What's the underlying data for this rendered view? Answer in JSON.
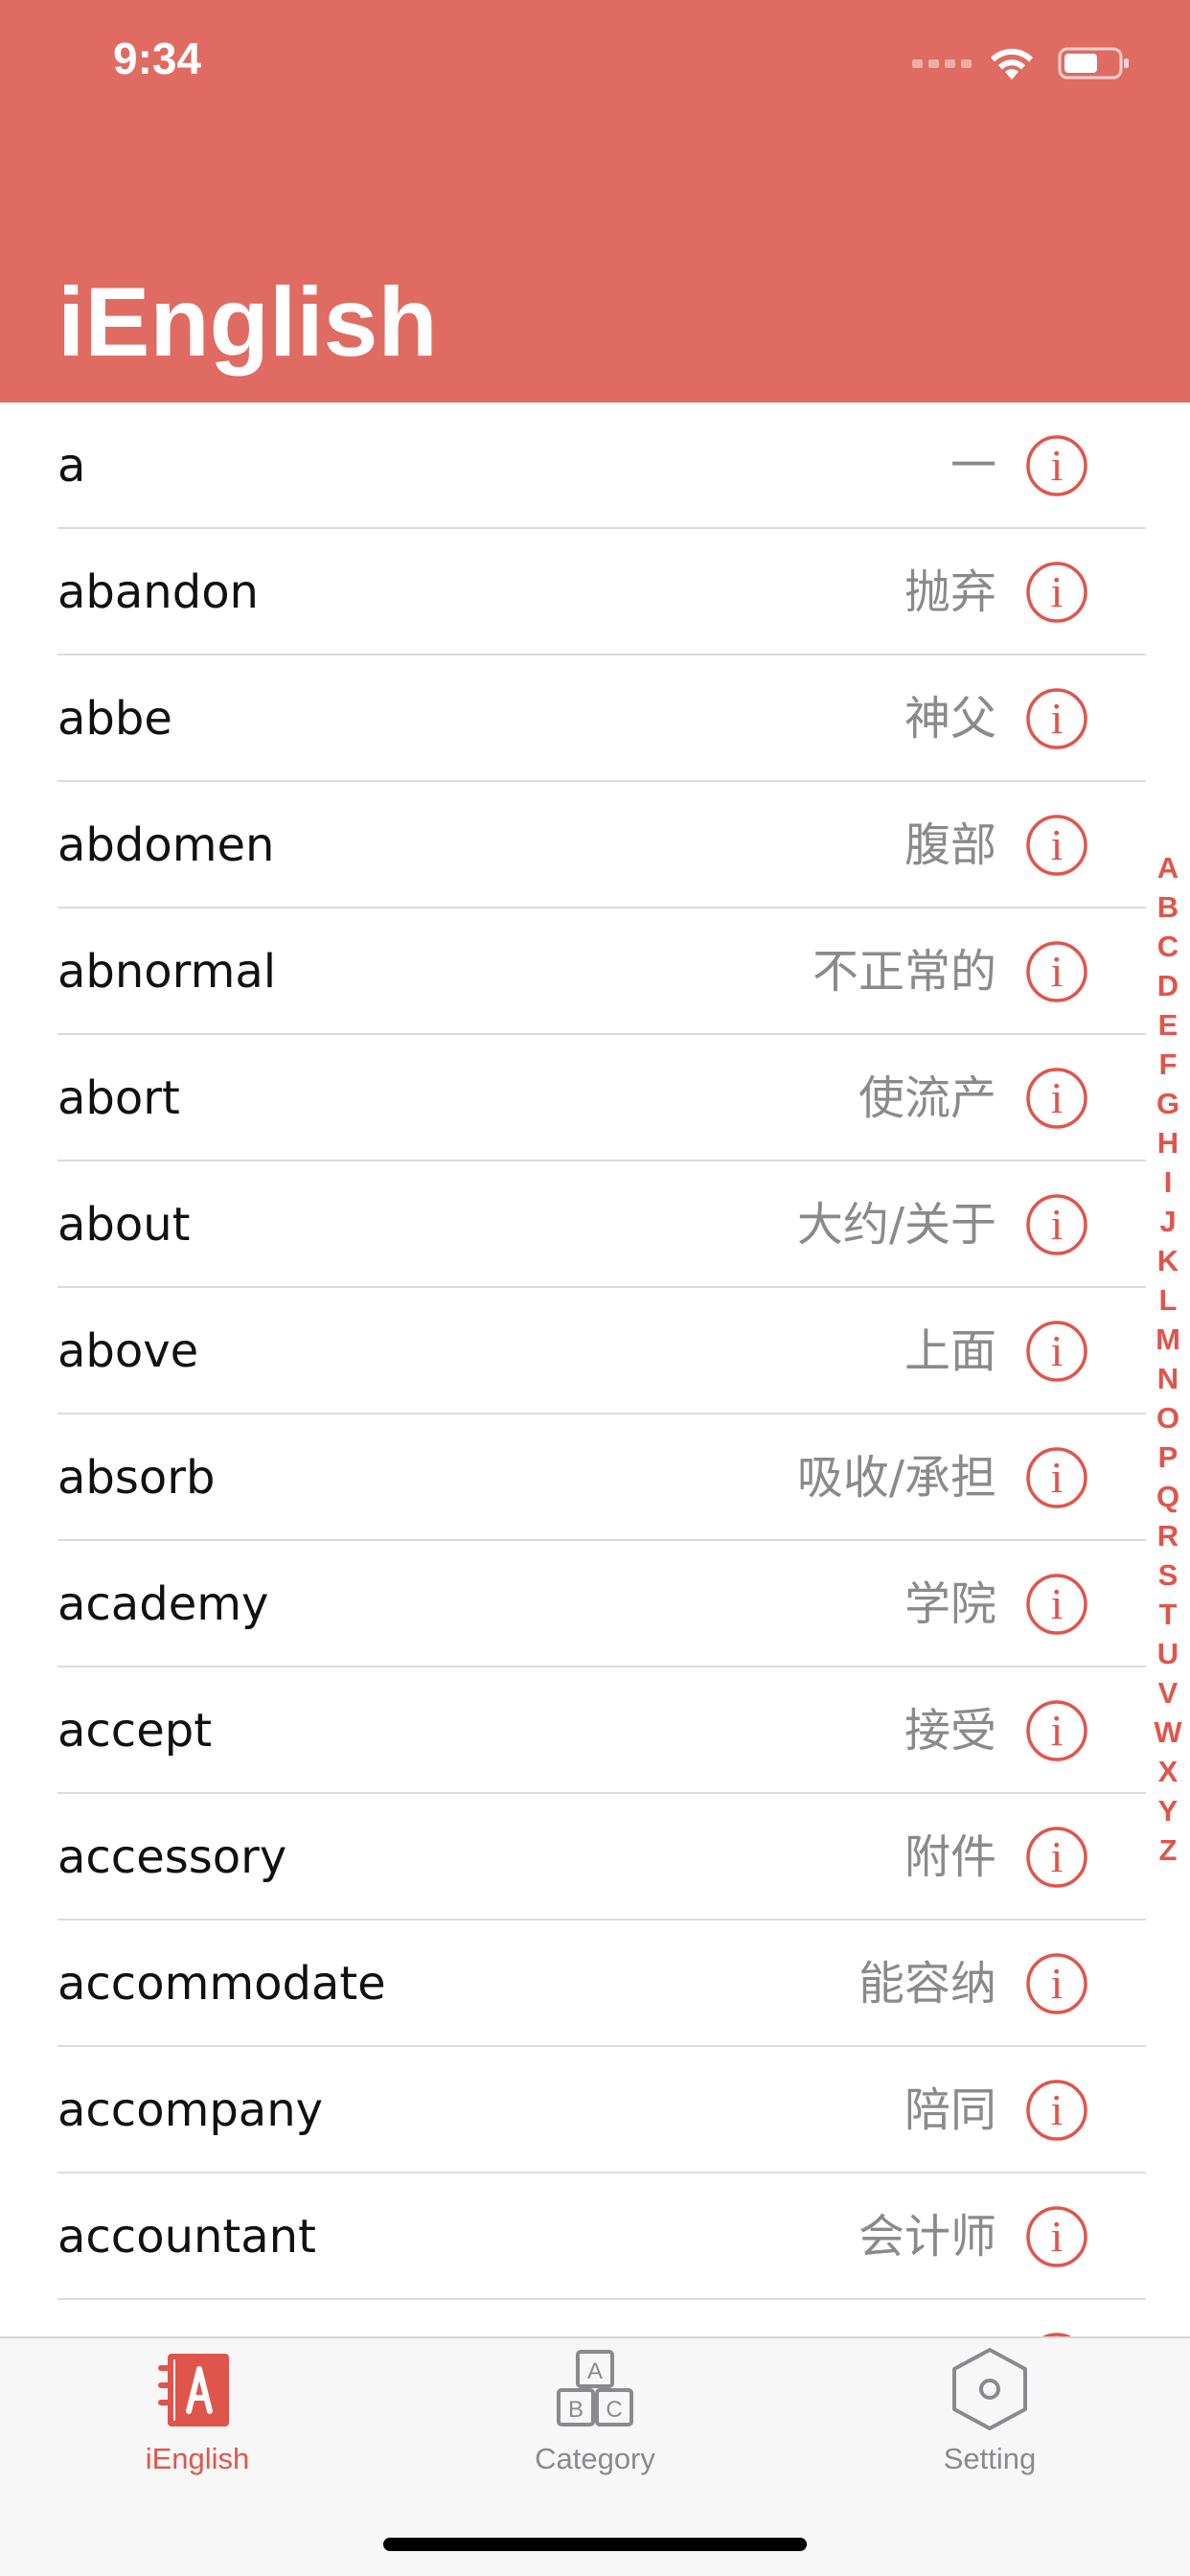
{
  "status_bar": {
    "time": "9:34"
  },
  "header": {
    "title": "iEnglish",
    "color": "#DF6B62"
  },
  "words": [
    {
      "word": "a",
      "meaning": "一"
    },
    {
      "word": "abandon",
      "meaning": "抛弃"
    },
    {
      "word": "abbe",
      "meaning": "神父"
    },
    {
      "word": "abdomen",
      "meaning": "腹部"
    },
    {
      "word": "abnormal",
      "meaning": "不正常的"
    },
    {
      "word": "abort",
      "meaning": "使流产"
    },
    {
      "word": "about",
      "meaning": "大约/关于"
    },
    {
      "word": "above",
      "meaning": "上面"
    },
    {
      "word": "absorb",
      "meaning": "吸收/承担"
    },
    {
      "word": "academy",
      "meaning": "学院"
    },
    {
      "word": "accept",
      "meaning": "接受"
    },
    {
      "word": "accessory",
      "meaning": "附件"
    },
    {
      "word": "accommodate",
      "meaning": "能容纳"
    },
    {
      "word": "accompany",
      "meaning": "陪同"
    },
    {
      "word": "accountant",
      "meaning": "会计师"
    },
    {
      "word": "",
      "meaning": ""
    }
  ],
  "alphabet_index": [
    "A",
    "B",
    "C",
    "D",
    "E",
    "F",
    "G",
    "H",
    "I",
    "J",
    "K",
    "L",
    "M",
    "N",
    "O",
    "P",
    "Q",
    "R",
    "S",
    "T",
    "U",
    "V",
    "W",
    "X",
    "Y",
    "Z"
  ],
  "tabs": [
    {
      "label": "iEnglish",
      "icon": "notebook-a-icon",
      "active": true
    },
    {
      "label": "Category",
      "icon": "abc-blocks-icon",
      "active": false
    },
    {
      "label": "Setting",
      "icon": "hexagon-gear-icon",
      "active": false
    }
  ],
  "colors": {
    "accent": "#E0554B",
    "meaning_text": "#8A8A8E",
    "separator": "#DCDCDE",
    "tab_inactive": "#8A8A8E"
  }
}
